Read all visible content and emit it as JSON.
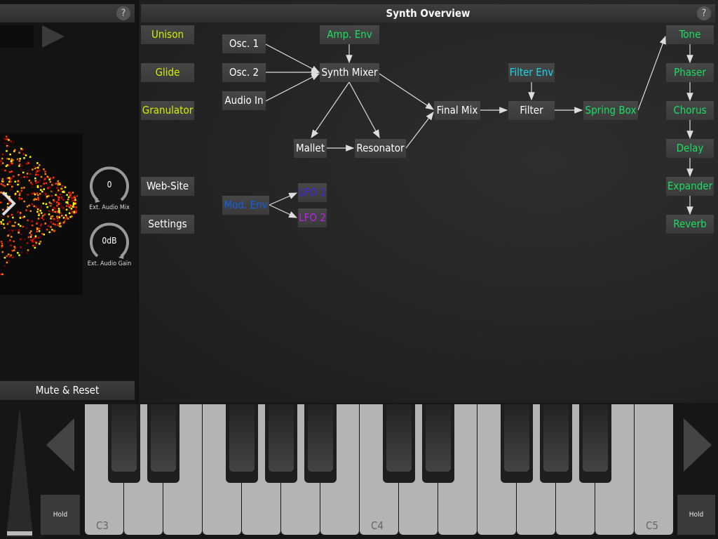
{
  "left_panel": {
    "help": "?",
    "mute_reset": "Mute & Reset",
    "knobs": [
      {
        "value": "0",
        "label": "Ext. Audio Mix"
      },
      {
        "value": "0dB",
        "label": "Ext. Audio Gain"
      }
    ]
  },
  "overview": {
    "title": "Synth Overview",
    "help": "?",
    "nodes": {
      "unison": "Unison",
      "glide": "Glide",
      "granulator": "Granulator",
      "website": "Web-Site",
      "settings": "Settings",
      "osc1": "Osc. 1",
      "osc2": "Osc. 2",
      "audio_in": "Audio In",
      "amp_env": "Amp. Env",
      "synth_mixer": "Synth Mixer",
      "mallet": "Mallet",
      "resonator": "Resonator",
      "final_mix": "Final Mix",
      "filter_env": "Filter Env",
      "filter": "Filter",
      "spring_box": "Spring Box",
      "tone": "Tone",
      "phaser": "Phaser",
      "chorus": "Chorus",
      "delay": "Delay",
      "expander": "Expander",
      "reverb": "Reverb",
      "mod_env": "Mod. Env",
      "lfo1": "LFO 1",
      "lfo2": "LFO 2"
    }
  },
  "colors": {
    "global": "#d4f000",
    "effect": "#18e060",
    "filter_env": "#18d8e8",
    "mod_env": "#1060e8",
    "lfo1": "#4020f0",
    "lfo2": "#c020f0"
  },
  "keyboard": {
    "labels": {
      "c3": "C3",
      "c4": "C4",
      "c5": "C5"
    },
    "hold_left": "Hold",
    "hold_right": "Hold"
  }
}
